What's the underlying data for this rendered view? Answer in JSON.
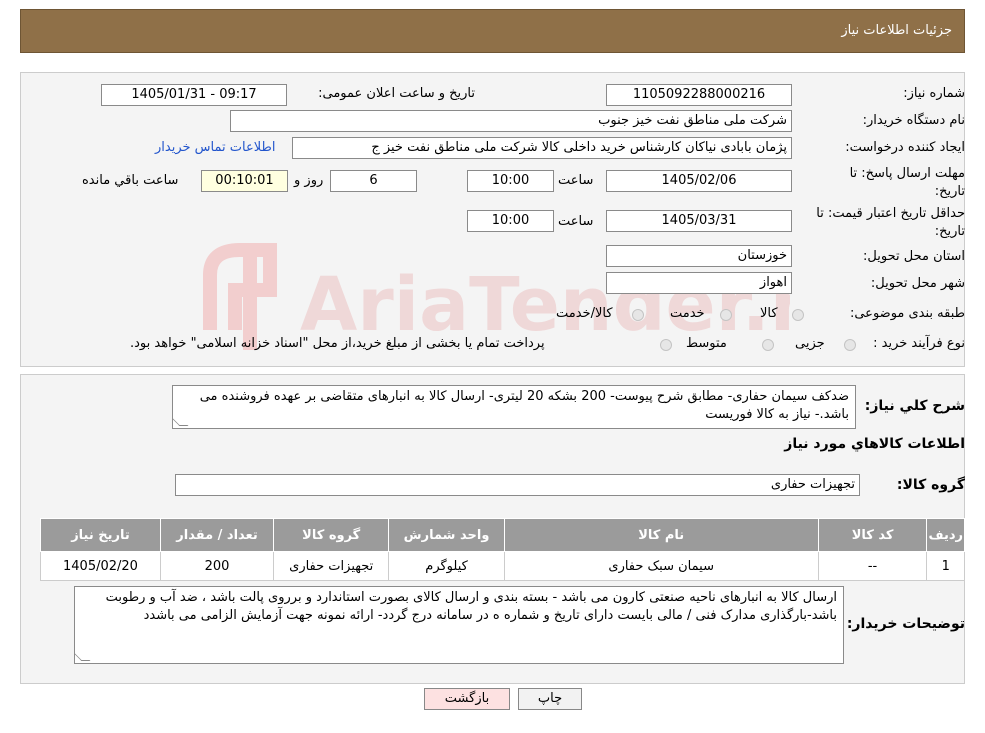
{
  "header": {
    "title": "جزئیات اطلاعات نیاز"
  },
  "labels": {
    "need_number": "شماره نیاز:",
    "announce_datetime": "تاریخ و ساعت اعلان عمومی:",
    "buyer_org": "نام دستگاه خریدار:",
    "requester": "ایجاد کننده درخواست:",
    "reply_deadline_line1": "مهلت ارسال پاسخ: تا",
    "reply_deadline_line2": "تاریخ:",
    "time": "ساعت",
    "days_and": "روز و",
    "remaining": "ساعت باقي مانده",
    "price_validity_line1": "حداقل تاریخ اعتبار قیمت: تا",
    "price_validity_line2": "تاریخ:",
    "delivery_province": "استان محل تحویل:",
    "delivery_city": "شهر محل تحویل:",
    "category": "طبقه بندی موضوعی:",
    "purchase_type": "نوع فرآیند خرید :",
    "general_desc": "شرح کلي نياز:",
    "goods_info": "اطلاعات کالاهاي مورد نياز",
    "goods_group": "گروه کالا:",
    "buyer_notes": "توضیحات خریدار:"
  },
  "fields": {
    "need_number": "1105092288000216",
    "announce_datetime": "1405/01/31 - 09:17",
    "buyer_org": "شرکت ملی مناطق نفت خیز جنوب",
    "requester": "پژمان  بابادی نیاکان  کارشناس خرید داخلی کالا  شرکت ملی مناطق نفت خیز ج",
    "contact_link": "اطلاعات تماس خریدار",
    "reply_date": "1405/02/06",
    "reply_time": "10:00",
    "reply_days": "6",
    "remaining_time": "00:10:01",
    "validity_date": "1405/03/31",
    "validity_time": "10:00",
    "province": "خوزستان",
    "city": "اهواز"
  },
  "category_options": [
    "کالا",
    "خدمت",
    "کالا/خدمت"
  ],
  "purchase_options": [
    "جزیی",
    "متوسط"
  ],
  "purchase_note": "پرداخت تمام یا بخشی از مبلغ خرید،از محل \"اسناد خزانه اسلامی\" خواهد بود.",
  "general_desc_text": "ضدکف سیمان حفاری- مطابق شرح پیوست- 200 بشکه 20 لیتری- ارسال کالا به انبارهای متقاضی بر عهده فروشنده می باشد.- نیاز به کالا فوریست",
  "goods_group_value": "تجهیزات حفاری",
  "table": {
    "headers": [
      "ردیف",
      "کد کالا",
      "نام کالا",
      "واحد شمارش",
      "گروه کالا",
      "تعداد / مقدار",
      "تاریخ نیاز"
    ],
    "rows": [
      [
        "1",
        "--",
        "سیمان سبک حفاری",
        "کیلوگرم",
        "تجهیزات حفاری",
        "200",
        "1405/02/20"
      ]
    ]
  },
  "buyer_notes_text": "ارسال کالا به انبارهای  ناحیه صنعتی  کارون می باشد  - بسته بندی و ارسال کالای بصورت استاندارد و برروی پالت باشد ، ضد آب و رطوبت باشد-بارگذاری مدارک فنی / مالی بایست دارای تاریخ و شماره ه در سامانه درج گردد- ارائه نمونه جهت آزمایش الزامی می باشدد",
  "buttons": {
    "print": "چاپ",
    "back": "بازگشت"
  },
  "colors": {
    "header_bg": "#8f7048",
    "table_header_bg": "#9b9b9b",
    "link": "#2255cc",
    "back_btn_bg": "#fde1e1"
  },
  "watermark": {
    "text": "AriaTender.neT"
  }
}
